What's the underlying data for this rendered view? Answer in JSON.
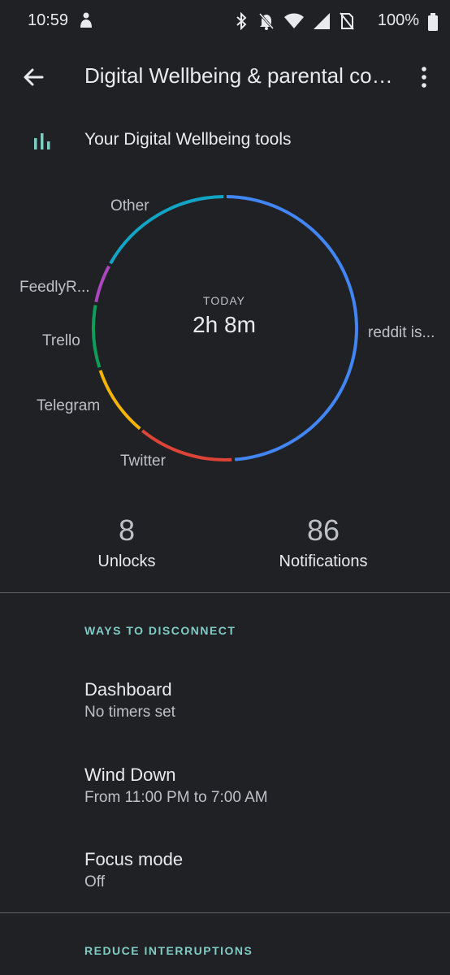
{
  "status_bar": {
    "time": "10:59",
    "battery": "100%",
    "icons": [
      "notification-app-icon",
      "bluetooth-icon",
      "notifications-off-icon",
      "wifi-icon",
      "cell-signal-icon",
      "no-sim-icon"
    ]
  },
  "app_bar": {
    "title": "Digital Wellbeing & parental controls"
  },
  "tools_row": {
    "label": "Your Digital Wellbeing tools"
  },
  "usage": {
    "period_label": "TODAY",
    "total": "2h 8m"
  },
  "chart_data": {
    "type": "pie",
    "style": "donut",
    "segments": [
      {
        "label": "reddit is...",
        "fraction": 0.49,
        "color": "#4285f4"
      },
      {
        "label": "Twitter",
        "fraction": 0.12,
        "color": "#db4437"
      },
      {
        "label": "Telegram",
        "fraction": 0.09,
        "color": "#f4b400"
      },
      {
        "label": "Trello",
        "fraction": 0.08,
        "color": "#0f9d58"
      },
      {
        "label": "FeedlyR...",
        "fraction": 0.05,
        "color": "#ab47bc"
      },
      {
        "label": "Other",
        "fraction": 0.17,
        "color": "#12a4c4"
      }
    ]
  },
  "stats": {
    "unlocks_count": "8",
    "unlocks_label": "Unlocks",
    "notifications_count": "86",
    "notifications_label": "Notifications"
  },
  "ways_to_disconnect": {
    "header": "WAYS TO DISCONNECT",
    "items": [
      {
        "title": "Dashboard",
        "subtitle": "No timers set"
      },
      {
        "title": "Wind Down",
        "subtitle": "From 11:00 PM to 7:00 AM"
      },
      {
        "title": "Focus mode",
        "subtitle": "Off"
      }
    ]
  },
  "reduce_interruptions": {
    "header": "REDUCE INTERRUPTIONS"
  },
  "colors": {
    "background": "#202124",
    "accent": "#80cbc4"
  }
}
